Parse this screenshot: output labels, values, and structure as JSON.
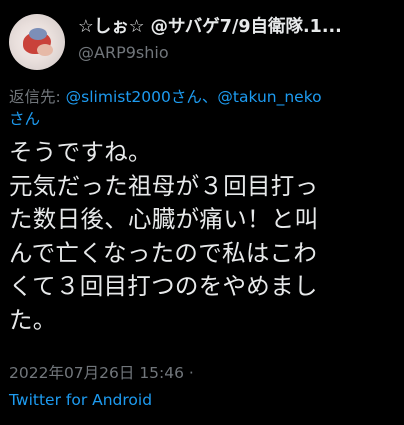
{
  "author": {
    "display_name": "☆しぉ☆ @サバゲ7/9自衛隊.1...",
    "handle": "@ARP9shio"
  },
  "reply": {
    "prefix": "返信先: ",
    "mention_1": "@slimist2000さん",
    "separator": "、",
    "mention_2": "@takun_neko",
    "suffix": "さん"
  },
  "tweet": {
    "lines": [
      "そうですね。",
      "元気だった祖母が３回目打っ",
      "た数日後、心臓が痛い！と叫",
      "んで亡くなったので私はこわ",
      "くて３回目打つのをやめまし",
      "た。"
    ],
    "timestamp": "2022年07月26日 15:46 ·",
    "source": "Twitter for Android"
  },
  "icons": {
    "avatar": "profile-photo",
    "more": "more-horizontal-icon"
  },
  "colors": {
    "background": "#000000",
    "text": "#e7e9ea",
    "muted": "#71767b",
    "link": "#1d9bf0"
  }
}
